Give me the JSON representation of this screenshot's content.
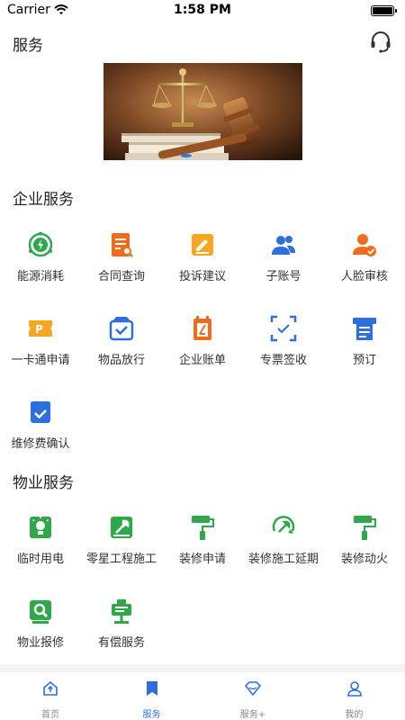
{
  "status_bar": {
    "carrier": "Carrier",
    "time": "1:58 PM"
  },
  "header": {
    "title": "服务",
    "icon": "headset-icon"
  },
  "banner": {
    "alt": "gavel-scales-image"
  },
  "enterprise": {
    "title": "企业服务",
    "items": [
      {
        "label": "能源消耗",
        "icon": "energy-icon",
        "color": "#2ea84a"
      },
      {
        "label": "合同查询",
        "icon": "contract-search-icon",
        "color": "#f26b1d"
      },
      {
        "label": "投诉建议",
        "icon": "complaint-icon",
        "color": "#f5a623"
      },
      {
        "label": "子账号",
        "icon": "sub-account-icon",
        "color": "#2d6fdf"
      },
      {
        "label": "人脸审核",
        "icon": "face-review-icon",
        "color": "#f26b1d"
      },
      {
        "label": "一卡通申请",
        "icon": "card-icon",
        "color": "#f5a623"
      },
      {
        "label": "物品放行",
        "icon": "goods-release-icon",
        "color": "#2d6fdf"
      },
      {
        "label": "企业账单",
        "icon": "bill-icon",
        "color": "#f26b1d"
      },
      {
        "label": "专票签收",
        "icon": "invoice-scan-icon",
        "color": "#2d6fdf"
      },
      {
        "label": "预订",
        "icon": "booking-icon",
        "color": "#2d6fdf"
      },
      {
        "label": "维修费确认",
        "icon": "repair-fee-icon",
        "color": "#2d6fdf"
      }
    ]
  },
  "property": {
    "title": "物业服务",
    "items": [
      {
        "label": "临时用电",
        "icon": "temp-power-icon",
        "color": "#2ea84a"
      },
      {
        "label": "零星工程施工",
        "icon": "construction-icon",
        "color": "#2ea84a"
      },
      {
        "label": "装修申请",
        "icon": "paint-roller-icon",
        "color": "#2ea84a"
      },
      {
        "label": "装修施工延期",
        "icon": "delay-icon",
        "color": "#2ea84a"
      },
      {
        "label": "装修动火",
        "icon": "paint-roller-icon",
        "color": "#2ea84a"
      },
      {
        "label": "物业报修",
        "icon": "repair-icon",
        "color": "#2ea84a"
      },
      {
        "label": "有偿服务",
        "icon": "paid-service-icon",
        "color": "#2ea84a"
      }
    ]
  },
  "tabbar": {
    "active_index": 1,
    "active_color": "#2d6fdf",
    "items": [
      {
        "label": "首页",
        "icon": "home-icon"
      },
      {
        "label": "服务",
        "icon": "bookmark-icon"
      },
      {
        "label": "服务+",
        "icon": "diamond-icon"
      },
      {
        "label": "我的",
        "icon": "user-icon"
      }
    ]
  }
}
